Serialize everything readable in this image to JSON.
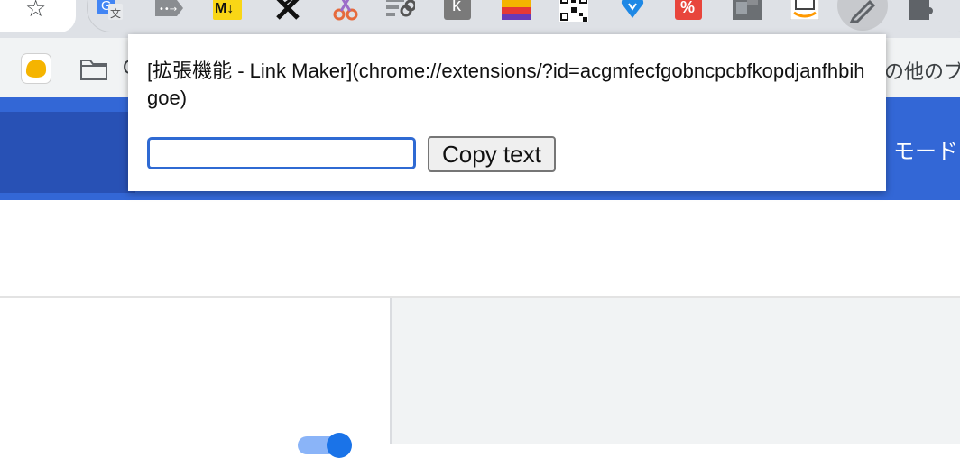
{
  "browser": {
    "toolbar": {
      "bookmark_star_icon": "star-outline",
      "extensions": [
        {
          "name": "google-translate-icon"
        },
        {
          "name": "send-arrow-icon"
        },
        {
          "name": "markdown-icon",
          "label": "M↓"
        },
        {
          "name": "x-tool-icon"
        },
        {
          "name": "scissors-icon"
        },
        {
          "name": "link-list-icon"
        },
        {
          "name": "k-icon",
          "label": "k"
        },
        {
          "name": "color-bars-icon"
        },
        {
          "name": "qr-code-icon"
        },
        {
          "name": "blue-heart-icon"
        },
        {
          "name": "red-percent-icon"
        },
        {
          "name": "gray-blocks-icon"
        },
        {
          "name": "amazon-icon"
        },
        {
          "name": "pencil-icon"
        },
        {
          "name": "puzzle-icon"
        }
      ]
    },
    "bookmarks_bar": {
      "folder_label": "C",
      "other_bookmarks_label": "その他のブック"
    }
  },
  "page": {
    "header_right_text": "モード"
  },
  "popup": {
    "link_text": "[拡張機能 - Link Maker](chrome://extensions/?id=acgmfecfgobncpcbfkopdjanfhbihgoe)",
    "input_value": "",
    "copy_button_label": "Copy text"
  },
  "colors": {
    "header_blue": "#3367d6",
    "input_border": "#2f6ad3",
    "toggle_blue": "#1a73e8"
  }
}
